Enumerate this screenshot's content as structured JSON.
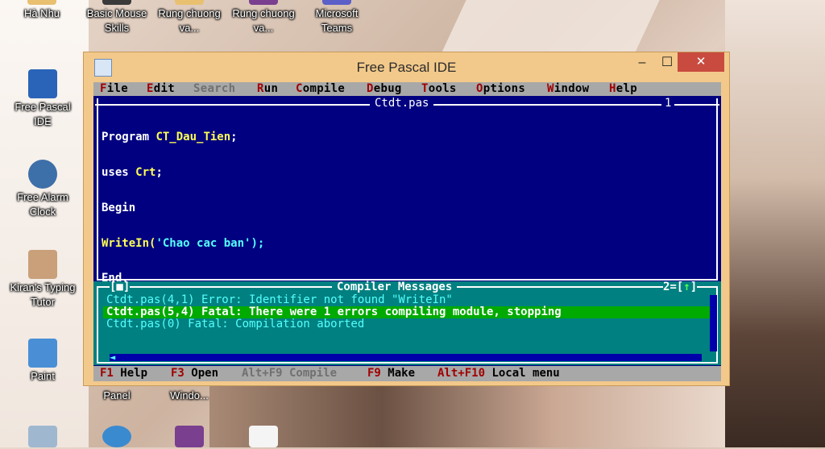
{
  "desktop": {
    "icons": [
      {
        "label": "Hà Nhu"
      },
      {
        "label": "Basic Mouse Skills"
      },
      {
        "label": "Rung chuong va..."
      },
      {
        "label": "Rung chuong va..."
      },
      {
        "label": "Microsoft Teams"
      },
      {
        "label": "Free Pascal IDE"
      },
      {
        "label": "Free Alarm Clock"
      },
      {
        "label": "Kiran's Typing Tutor"
      },
      {
        "label": "Paint"
      },
      {
        "label": "Panel"
      },
      {
        "label": "Windo..."
      }
    ]
  },
  "window": {
    "title": "Free Pascal IDE",
    "minimize": "–",
    "maximize": "☐",
    "close": "✕"
  },
  "menu": {
    "items": [
      {
        "hot": "F",
        "rest": "ile"
      },
      {
        "hot": "E",
        "rest": "dit"
      },
      {
        "hot": "S",
        "rest": "earch"
      },
      {
        "hot": "R",
        "rest": "un"
      },
      {
        "hot": "C",
        "rest": "ompile"
      },
      {
        "hot": "D",
        "rest": "ebug"
      },
      {
        "hot": "T",
        "rest": "ools"
      },
      {
        "hot": "O",
        "rest": "ptions"
      },
      {
        "hot": "W",
        "rest": "indow"
      },
      {
        "hot": "H",
        "rest": "elp"
      }
    ]
  },
  "editor": {
    "filename": "Ctdt.pas",
    "window_number": "1",
    "lines": [
      {
        "a": "Program ",
        "b": "CT_Dau_Tien",
        "c": ";"
      },
      {
        "a": "uses ",
        "b": "Crt",
        "c": ";"
      },
      {
        "a": "Begin",
        "b": "",
        "c": ""
      },
      {
        "a": "",
        "b": "WriteIn(",
        "c": "'Chao cac ban');"
      },
      {
        "a": "End.",
        "b": "",
        "c": ""
      }
    ]
  },
  "messages": {
    "close_glyph": "[■]",
    "title": "Compiler Messages",
    "number": "2=[",
    "number_arrow": "↑",
    "number_end": "]",
    "lines": [
      "Ctdt.pas(4,1) Error: Identifier not found \"WriteIn\"",
      "Ctdt.pas(5,4) Fatal: There were 1 errors compiling module, stopping",
      "Ctdt.pas(0) Fatal: Compilation aborted"
    ]
  },
  "status": {
    "items": [
      {
        "key": "F1",
        "label": " Help"
      },
      {
        "key": "F3",
        "label": " Open"
      },
      {
        "key": "Alt+F9",
        "label": " Compile"
      },
      {
        "key": "F9",
        "label": " Make"
      },
      {
        "key": "Alt+F10",
        "label": " Local menu"
      }
    ]
  }
}
